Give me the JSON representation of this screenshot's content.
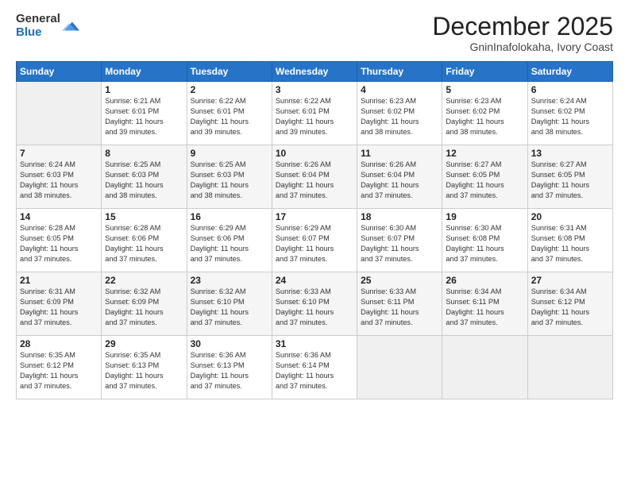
{
  "logo": {
    "general": "General",
    "blue": "Blue"
  },
  "header": {
    "month": "December 2025",
    "location": "GninInafolokaha, Ivory Coast"
  },
  "weekdays": [
    "Sunday",
    "Monday",
    "Tuesday",
    "Wednesday",
    "Thursday",
    "Friday",
    "Saturday"
  ],
  "weeks": [
    [
      {
        "day": "",
        "info": ""
      },
      {
        "day": "1",
        "info": "Sunrise: 6:21 AM\nSunset: 6:01 PM\nDaylight: 11 hours\nand 39 minutes."
      },
      {
        "day": "2",
        "info": "Sunrise: 6:22 AM\nSunset: 6:01 PM\nDaylight: 11 hours\nand 39 minutes."
      },
      {
        "day": "3",
        "info": "Sunrise: 6:22 AM\nSunset: 6:01 PM\nDaylight: 11 hours\nand 39 minutes."
      },
      {
        "day": "4",
        "info": "Sunrise: 6:23 AM\nSunset: 6:02 PM\nDaylight: 11 hours\nand 38 minutes."
      },
      {
        "day": "5",
        "info": "Sunrise: 6:23 AM\nSunset: 6:02 PM\nDaylight: 11 hours\nand 38 minutes."
      },
      {
        "day": "6",
        "info": "Sunrise: 6:24 AM\nSunset: 6:02 PM\nDaylight: 11 hours\nand 38 minutes."
      }
    ],
    [
      {
        "day": "7",
        "info": "Sunrise: 6:24 AM\nSunset: 6:03 PM\nDaylight: 11 hours\nand 38 minutes."
      },
      {
        "day": "8",
        "info": "Sunrise: 6:25 AM\nSunset: 6:03 PM\nDaylight: 11 hours\nand 38 minutes."
      },
      {
        "day": "9",
        "info": "Sunrise: 6:25 AM\nSunset: 6:03 PM\nDaylight: 11 hours\nand 38 minutes."
      },
      {
        "day": "10",
        "info": "Sunrise: 6:26 AM\nSunset: 6:04 PM\nDaylight: 11 hours\nand 37 minutes."
      },
      {
        "day": "11",
        "info": "Sunrise: 6:26 AM\nSunset: 6:04 PM\nDaylight: 11 hours\nand 37 minutes."
      },
      {
        "day": "12",
        "info": "Sunrise: 6:27 AM\nSunset: 6:05 PM\nDaylight: 11 hours\nand 37 minutes."
      },
      {
        "day": "13",
        "info": "Sunrise: 6:27 AM\nSunset: 6:05 PM\nDaylight: 11 hours\nand 37 minutes."
      }
    ],
    [
      {
        "day": "14",
        "info": "Sunrise: 6:28 AM\nSunset: 6:05 PM\nDaylight: 11 hours\nand 37 minutes."
      },
      {
        "day": "15",
        "info": "Sunrise: 6:28 AM\nSunset: 6:06 PM\nDaylight: 11 hours\nand 37 minutes."
      },
      {
        "day": "16",
        "info": "Sunrise: 6:29 AM\nSunset: 6:06 PM\nDaylight: 11 hours\nand 37 minutes."
      },
      {
        "day": "17",
        "info": "Sunrise: 6:29 AM\nSunset: 6:07 PM\nDaylight: 11 hours\nand 37 minutes."
      },
      {
        "day": "18",
        "info": "Sunrise: 6:30 AM\nSunset: 6:07 PM\nDaylight: 11 hours\nand 37 minutes."
      },
      {
        "day": "19",
        "info": "Sunrise: 6:30 AM\nSunset: 6:08 PM\nDaylight: 11 hours\nand 37 minutes."
      },
      {
        "day": "20",
        "info": "Sunrise: 6:31 AM\nSunset: 6:08 PM\nDaylight: 11 hours\nand 37 minutes."
      }
    ],
    [
      {
        "day": "21",
        "info": "Sunrise: 6:31 AM\nSunset: 6:09 PM\nDaylight: 11 hours\nand 37 minutes."
      },
      {
        "day": "22",
        "info": "Sunrise: 6:32 AM\nSunset: 6:09 PM\nDaylight: 11 hours\nand 37 minutes."
      },
      {
        "day": "23",
        "info": "Sunrise: 6:32 AM\nSunset: 6:10 PM\nDaylight: 11 hours\nand 37 minutes."
      },
      {
        "day": "24",
        "info": "Sunrise: 6:33 AM\nSunset: 6:10 PM\nDaylight: 11 hours\nand 37 minutes."
      },
      {
        "day": "25",
        "info": "Sunrise: 6:33 AM\nSunset: 6:11 PM\nDaylight: 11 hours\nand 37 minutes."
      },
      {
        "day": "26",
        "info": "Sunrise: 6:34 AM\nSunset: 6:11 PM\nDaylight: 11 hours\nand 37 minutes."
      },
      {
        "day": "27",
        "info": "Sunrise: 6:34 AM\nSunset: 6:12 PM\nDaylight: 11 hours\nand 37 minutes."
      }
    ],
    [
      {
        "day": "28",
        "info": "Sunrise: 6:35 AM\nSunset: 6:12 PM\nDaylight: 11 hours\nand 37 minutes."
      },
      {
        "day": "29",
        "info": "Sunrise: 6:35 AM\nSunset: 6:13 PM\nDaylight: 11 hours\nand 37 minutes."
      },
      {
        "day": "30",
        "info": "Sunrise: 6:36 AM\nSunset: 6:13 PM\nDaylight: 11 hours\nand 37 minutes."
      },
      {
        "day": "31",
        "info": "Sunrise: 6:36 AM\nSunset: 6:14 PM\nDaylight: 11 hours\nand 37 minutes."
      },
      {
        "day": "",
        "info": ""
      },
      {
        "day": "",
        "info": ""
      },
      {
        "day": "",
        "info": ""
      }
    ]
  ]
}
